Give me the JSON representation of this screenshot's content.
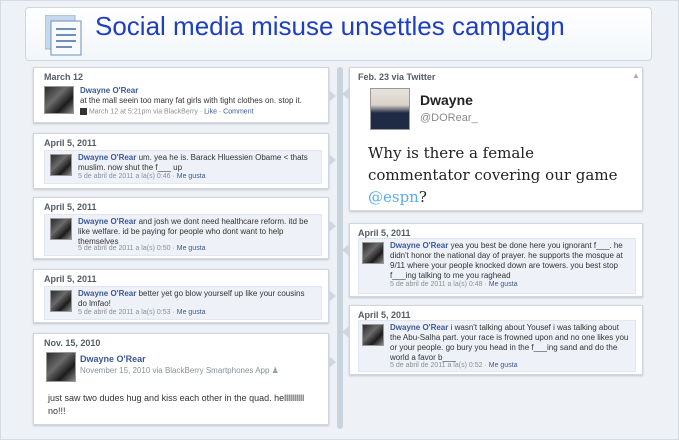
{
  "title": "Social media misuse unsettles campaign",
  "colors": {
    "title": "#1f3fbf",
    "link": "#3b5998",
    "twitter_mention": "#55acee",
    "background": "#eef2f6"
  },
  "icons": {
    "header": "document-icon"
  },
  "left_posts": [
    {
      "date": "March 12",
      "name": "Dwayne O'Rear",
      "text": "at the mall seein too many fat girls with tight clothes on. stop it.",
      "meta_time": "March 12 at 5:21pm via BlackBerry",
      "meta_links": "Like · Comment"
    },
    {
      "date": "April 5, 2011",
      "name": "Dwayne O'Rear",
      "text": "um. yea he is. Barack Hluessien Obame < thats muslim. now shut the f___ up",
      "meta_time": "5 de abril de 2011 a la(s) 0:46",
      "meta_links": "Me gusta"
    },
    {
      "date": "April 5, 2011",
      "name": "Dwayne O'Rear",
      "text": "and josh we dont need healthcare reform. itd be like welfare. id be paying for people who dont want to help themselves",
      "meta_time": "5 de abril de 2011 a la(s) 0:50",
      "meta_links": "Me gusta"
    },
    {
      "date": "April 5, 2011",
      "name": "Dwayne O'Rear",
      "text": "better yet go blow yourself up like your cousins do lmfao!",
      "meta_time": "5 de abril de 2011 a la(s) 0:53",
      "meta_links": "Me gusta"
    },
    {
      "date": "Nov. 15, 2010",
      "name": "Dwayne O'Rear",
      "sub": "November 15, 2010 via BlackBerry Smartphones App",
      "text": "just saw two dudes hug and kiss each other in the quad. hellllllllll no!!!"
    }
  ],
  "tweet": {
    "date": "Feb. 23 via Twitter",
    "name": "Dwayne",
    "handle": "@DORear_",
    "text_before": "Why is there a female commentator covering our game ",
    "mention": "@espn",
    "text_after": "?"
  },
  "right_posts": [
    {
      "date": "April 5, 2011",
      "name": "Dwayne O'Rear",
      "text": "yea you best be done here you ignorant f___. he didn't honor the national day of prayer. he supports the mosque at 9/11 where your people knocked down are towers. you best stop f___ing talking to me you raghead",
      "meta_time": "5 de abril de 2011 a la(s) 0:48",
      "meta_links": "Me gusta"
    },
    {
      "date": "April 5, 2011",
      "name": "Dwayne O'Rear",
      "text": "i wasn't talking about Yousef i was talking about the Abu-Salha part. your race is frowned upon and no one likes you or your people. go bury you head in the f___ing sand and do the world a favor b___",
      "meta_time": "5 de abril de 2011 a la(s) 0:52",
      "meta_links": "Me gusta"
    }
  ]
}
